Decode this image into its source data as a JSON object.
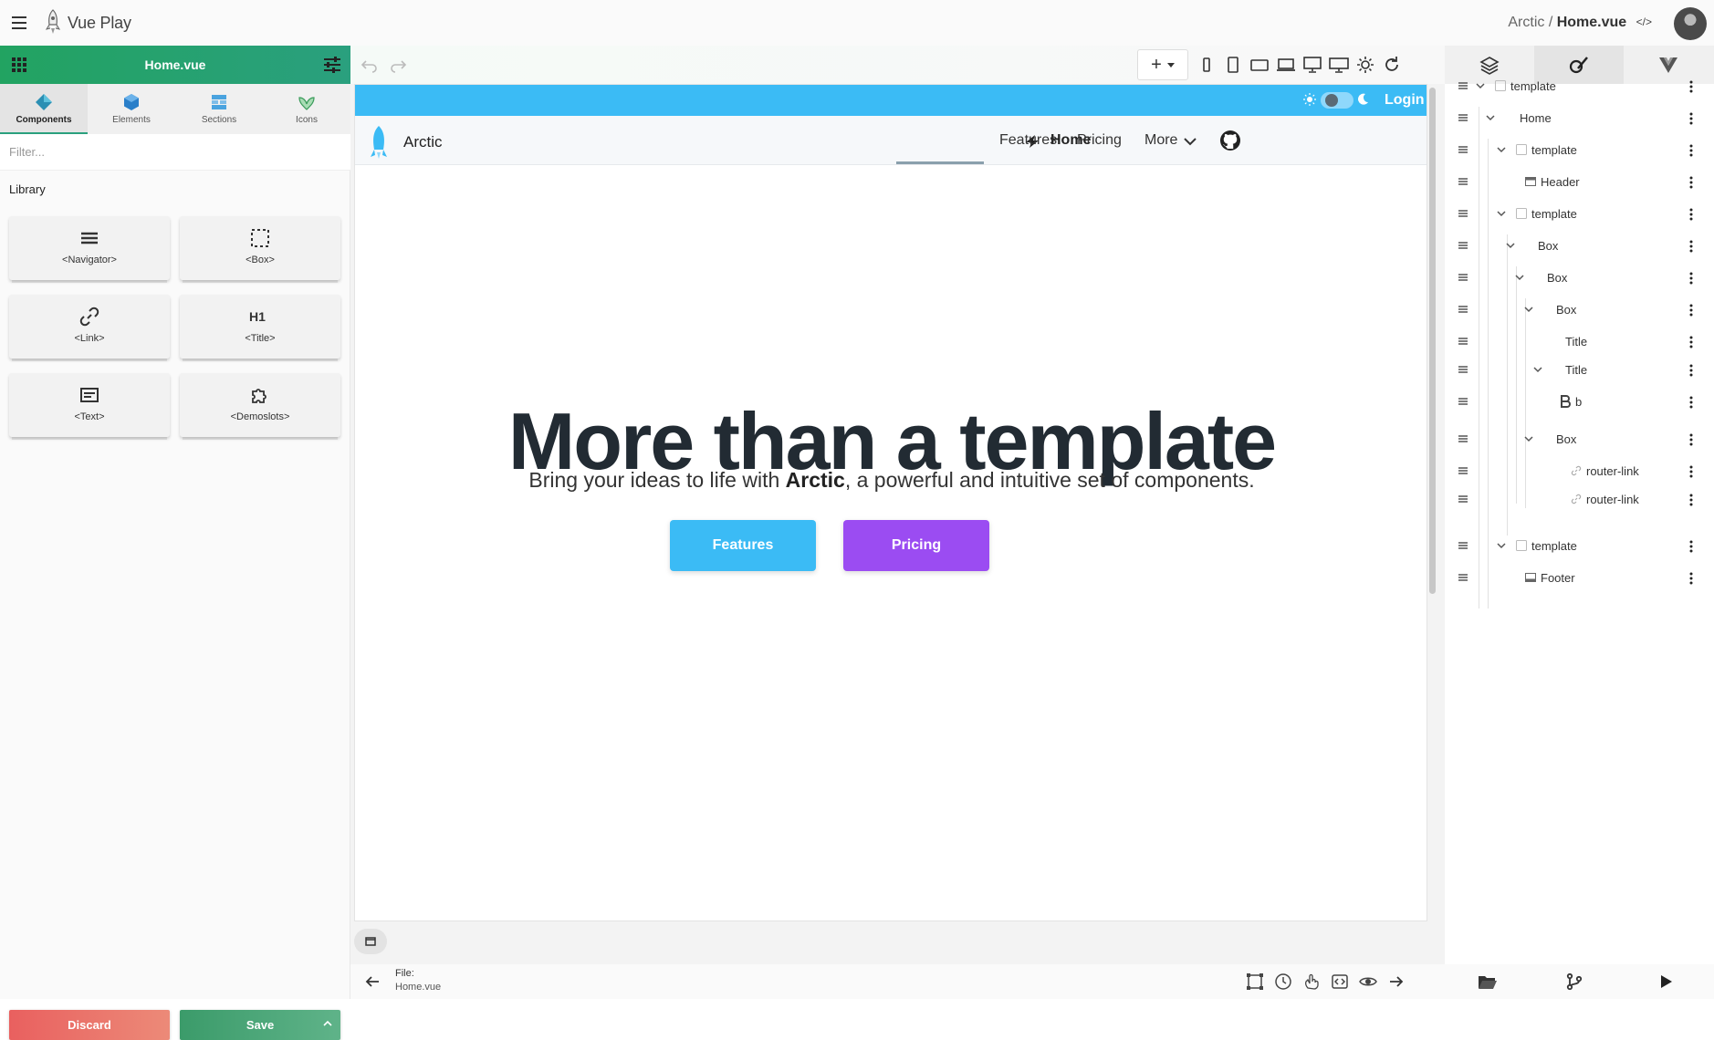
{
  "topbar": {
    "app_name": "Vue Play",
    "breadcrumb_project": "Arctic",
    "breadcrumb_sep": " / ",
    "breadcrumb_file": "Home.vue",
    "code_icon_text": "</>",
    "icons": [
      "hamburger-icon",
      "rocket-logo",
      "code-icon",
      "user-avatar"
    ]
  },
  "left_panel": {
    "title": "Home.vue",
    "tabs": [
      {
        "label": "Components",
        "icon": "diamond-icon",
        "active": true
      },
      {
        "label": "Elements",
        "icon": "cube-icon"
      },
      {
        "label": "Sections",
        "icon": "sections-icon"
      },
      {
        "label": "Icons",
        "icon": "leaf-icon"
      }
    ],
    "filter_placeholder": "Filter...",
    "library_label": "Library",
    "library_items": [
      {
        "label": "<Navigator>",
        "icon": "menu-lines-icon"
      },
      {
        "label": "<Box>",
        "icon": "dashed-box-icon"
      },
      {
        "label": "<Link>",
        "icon": "link-icon"
      },
      {
        "label": "<Title>",
        "icon": "h1-icon",
        "glyph": "H1"
      },
      {
        "label": "<Text>",
        "icon": "text-block-icon"
      },
      {
        "label": "<Demoslots>",
        "icon": "puzzle-icon"
      }
    ],
    "discard_label": "Discard",
    "save_label": "Save"
  },
  "toolbar": {
    "add_symbol": "+",
    "device_icons": [
      "phone-portrait-icon",
      "tablet-portrait-icon",
      "tablet-landscape-icon",
      "laptop-icon",
      "desktop-icon",
      "wide-desktop-icon",
      "brightness-icon",
      "refresh-icon"
    ]
  },
  "preview": {
    "login_label": "Login",
    "brand": "Arctic",
    "nav": [
      {
        "label": "Home",
        "active": true
      },
      {
        "label": "Features"
      },
      {
        "label": "Pricing"
      },
      {
        "label": "More"
      }
    ],
    "hero_title": "More than a template",
    "hero_sub_before": "Bring your ideas to life with ",
    "hero_sub_bold": "Arctic",
    "hero_sub_after": ", a powerful and intuitive set of components.",
    "btn_features": "Features",
    "btn_pricing": "Pricing",
    "colors": {
      "accent": "#3bbbf5",
      "pricing": "#9b4cf2",
      "title": "#222b33"
    }
  },
  "bottombar": {
    "file_label": "File:",
    "file_name": "Home.vue",
    "icons": [
      "selection-icon",
      "history-icon",
      "gesture-icon",
      "code-box-icon",
      "eye-icon",
      "arrow-right-icon"
    ]
  },
  "right_panel": {
    "tabs": [
      "layers-icon",
      "paint-icon",
      "vue-icon"
    ],
    "tree": [
      {
        "label": "template",
        "icon": "checkbox",
        "chevron": true
      },
      {
        "label": "Home",
        "icon": "",
        "chevron": true
      },
      {
        "label": "template",
        "icon": "checkbox",
        "chevron": true
      },
      {
        "label": "Header",
        "icon": "header-icon",
        "chevron": false
      },
      {
        "label": "template",
        "icon": "checkbox",
        "chevron": true
      },
      {
        "label": "Box",
        "icon": "",
        "chevron": true
      },
      {
        "label": "Box",
        "icon": "",
        "chevron": true
      },
      {
        "label": "Box",
        "icon": "",
        "chevron": true
      },
      {
        "label": "Title",
        "icon": "",
        "chevron": false
      },
      {
        "label": "Title",
        "icon": "",
        "chevron": true
      },
      {
        "label": "b",
        "icon": "bold-icon",
        "chevron": false
      },
      {
        "label": "Box",
        "icon": "",
        "chevron": true
      },
      {
        "label": "router-link",
        "icon": "link-icon",
        "chevron": false
      },
      {
        "label": "router-link",
        "icon": "link-icon",
        "chevron": false
      },
      {
        "label": "template",
        "icon": "checkbox",
        "chevron": true
      },
      {
        "label": "Footer",
        "icon": "footer-icon",
        "chevron": false
      }
    ],
    "bottom_icons": [
      "folder-open-icon",
      "git-branch-icon",
      "play-icon"
    ]
  }
}
